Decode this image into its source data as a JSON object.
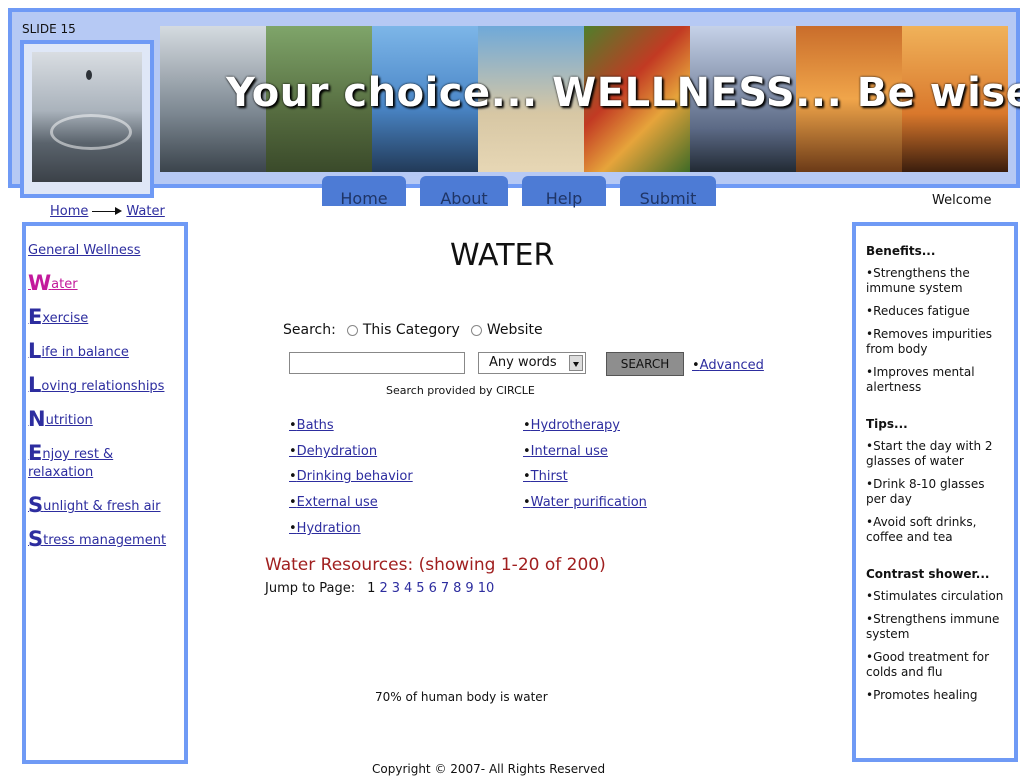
{
  "slide_label": "SLIDE 15",
  "banner": {
    "tagline": "Your choice... WELLNESS... Be wise"
  },
  "nav": {
    "tabs": [
      {
        "label": "Home"
      },
      {
        "label": "About"
      },
      {
        "label": "Help"
      },
      {
        "label": "Submit"
      }
    ]
  },
  "welcome": "Welcome",
  "breadcrumb": {
    "home": "Home",
    "current": "Water"
  },
  "left_nav": [
    {
      "first": "",
      "rest": "General Wellness",
      "active": false
    },
    {
      "first": "W",
      "rest": "ater",
      "active": true
    },
    {
      "first": "E",
      "rest": "xercise",
      "active": false
    },
    {
      "first": "L",
      "rest": "ife in balance",
      "active": false
    },
    {
      "first": "L",
      "rest": "oving relationships",
      "active": false
    },
    {
      "first": "N",
      "rest": "utrition",
      "active": false
    },
    {
      "first": "E",
      "rest": "njoy rest & relaxation",
      "active": false
    },
    {
      "first": "S",
      "rest": "unlight & fresh air",
      "active": false
    },
    {
      "first": "S",
      "rest": "tress management",
      "active": false
    }
  ],
  "page_title": "WATER",
  "search": {
    "label": "Search:",
    "option_category": "This Category",
    "option_website": "Website",
    "input_value": "",
    "mode_selected": "Any words",
    "button": "SEARCH",
    "advanced": "Advanced",
    "credit": "Search provided by CIRCLE"
  },
  "topics": {
    "col1": [
      "Baths",
      "Dehydration",
      "Drinking behavior",
      "External use",
      "Hydration"
    ],
    "col2": [
      "Hydrotherapy",
      "Internal use",
      "Thirst",
      "Water purification"
    ]
  },
  "resources": "Water Resources: (showing 1-20 of 200)",
  "jump": {
    "label": "Jump to Page:",
    "current": "1",
    "pages": [
      "2",
      "3",
      "4",
      "5",
      "6",
      "7",
      "8",
      "9",
      "10"
    ]
  },
  "fact": "70% of human body is water",
  "copyright": "Copyright © 2007- All Rights Reserved",
  "sidebar": {
    "benefits_title": "Benefits...",
    "benefits": [
      "Strengthens the immune system",
      "Reduces fatigue",
      "Removes impurities from body",
      "Improves mental alertness"
    ],
    "tips_title": "Tips...",
    "tips": [
      "Start the day with 2 glasses of water",
      "Drink 8-10 glasses per day",
      "Avoid soft drinks, coffee and tea"
    ],
    "shower_title": "Contrast shower...",
    "shower": [
      "Stimulates circulation",
      "Strengthens immune system",
      "Good treatment for colds and flu",
      "Promotes healing"
    ]
  }
}
